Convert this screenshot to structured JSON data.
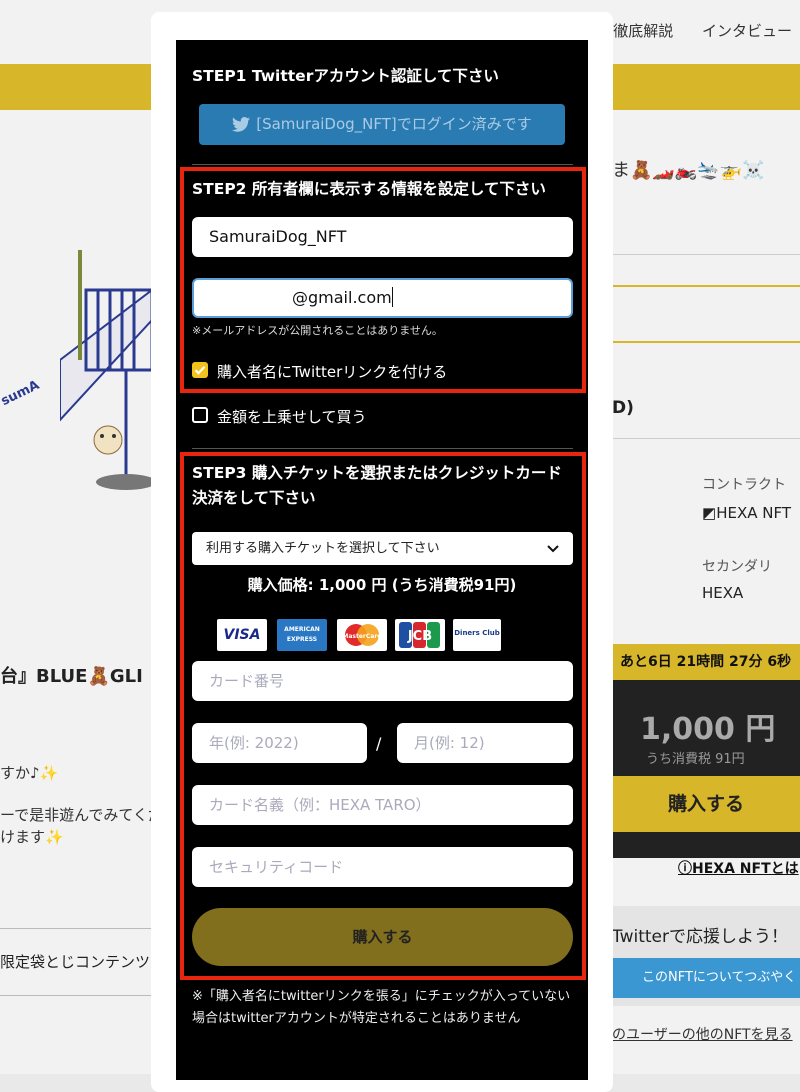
{
  "background": {
    "nav_items": [
      "T徹底解説",
      "インタビュー"
    ],
    "right_title": "ま🧸🏎️🏍️🛬🚁☠️",
    "right_d": "D)",
    "contract_label": "コントラクト",
    "contract_value": "HEXA NFT",
    "secondary_label": "セカンダリ",
    "secondary_value": "HEXA",
    "countdown": "あと6日 21時間 27分 6秒",
    "price": "1,000 円",
    "tax": "うち消費税 91円",
    "buy_label": "購入する",
    "hexa_link": "HEXA NFTとは",
    "twitter_title": "Twitterで応援しよう！",
    "twitter_btn": "このNFTについてつぶやく",
    "other_nfts": "のユーザーの他のNFTを見る",
    "left_title": "台』BLUE🧸GLI",
    "left_line1": "すか♪✨",
    "left_line2": "ーで是非遊んでみてくだ",
    "left_line3": "けます✨",
    "left_box": "限定袋とじコンテンツ",
    "slide_text": "sumA"
  },
  "modal": {
    "step1_title": "STEP1 Twitterアカウント認証して下さい",
    "twitter_login_label": "[SamuraiDog_NFT]でログイン済みです",
    "step2_title": "STEP2 所有者欄に表示する情報を設定して下さい",
    "name_value": "SamuraiDog_NFT",
    "email_value": "@gmail.com",
    "email_note": "※メールアドレスが公開されることはありません。",
    "twitter_link_label": "購入者名にTwitterリンクを付ける",
    "twitter_link_checked": true,
    "overpay_label": "金額を上乗せして買う",
    "overpay_checked": false,
    "step3_title_line1": "STEP3 購入チケットを選択またはクレジットカード",
    "step3_title_line2": "決済をして下さい",
    "ticket_select": "利用する購入チケットを選択して下さい",
    "price_text": "購入価格: 1,000 円 (うち消費税91円)",
    "card_brands": [
      "VISA",
      "AMERICAN EXPRESS",
      "MasterCard",
      "JCB",
      "Diners Club"
    ],
    "card_number_ph": "カード番号",
    "year_ph": "年(例: 2022)",
    "date_sep": "/",
    "month_ph": "月(例: 12)",
    "card_name_ph": "カード名義（例：HEXA TARO）",
    "security_ph": "セキュリティコード",
    "buy_button": "購入する",
    "footnote": "※「購入者名にtwitterリンクを張る」にチェックが入っていない場合はtwitterアカウントが特定されることはありません"
  },
  "colors": {
    "accent_gold": "#d7b62a",
    "highlight_red": "#e8250f",
    "twitter_blue": "#2b7bb3"
  }
}
